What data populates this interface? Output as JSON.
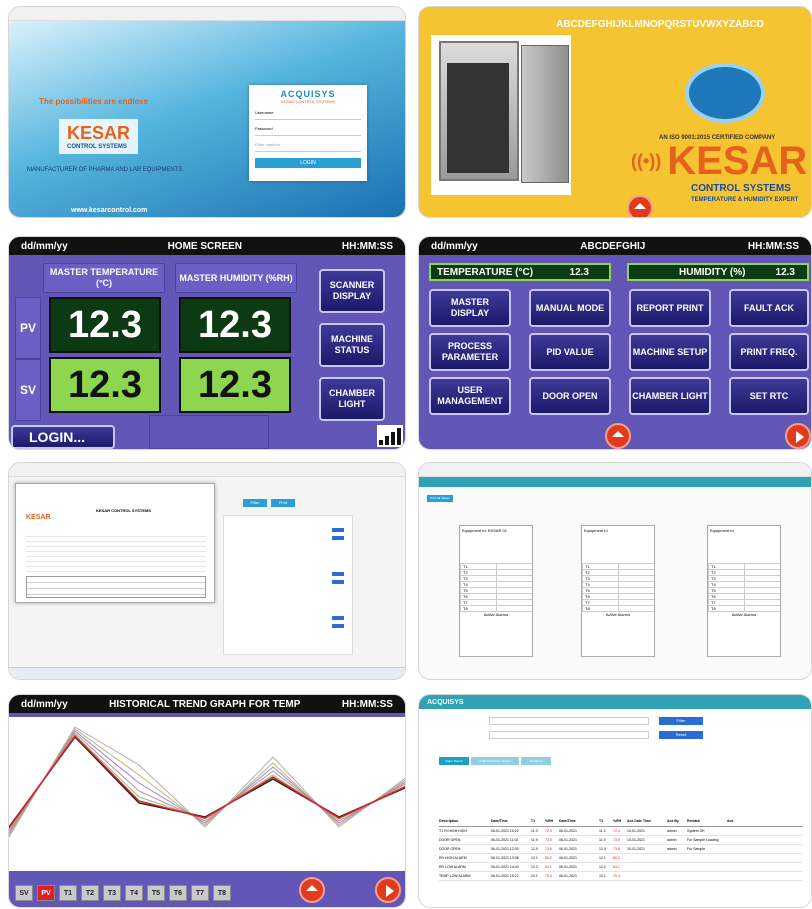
{
  "login": {
    "tagline": "The possibilities are endless",
    "brand": "KESAR",
    "brand_sub": "CONTROL SYSTEMS",
    "manufacturer": "MANUFACTURER OF PHARMA AND LAB EQUIPMENTS",
    "website": "www.kesarcontrol.com",
    "card_logo": "ACQUISYS",
    "card_sub": "KESAR CONTROL SYSTEMS",
    "username_label": "Username",
    "password_label": "Password",
    "captcha_placeholder": "Enter captcha",
    "login_button": "LOGIN"
  },
  "splash": {
    "alphabet": "ABCDEFGHIJKLMNOPQRSTUVWXYZABCD",
    "iso": "AN ISO 9001:2015 CERTIFIED COMPANY",
    "brand": "KESAR",
    "brand_sub": "CONTROL SYSTEMS",
    "tagline": "TEMPERATURE & HUMIDITY EXPERT"
  },
  "home": {
    "date": "dd/mm/yy",
    "title": "HOME SCREEN",
    "time": "HH:MM:SS",
    "temp_header": "MASTER TEMPERATURE (°C)",
    "hum_header": "MASTER HUMIDITY (%RH)",
    "pv_label": "PV",
    "sv_label": "SV",
    "pv_temp": "12.3",
    "pv_hum": "12.3",
    "sv_temp": "12.3",
    "sv_hum": "12.3",
    "scanner": "SCANNER DISPLAY",
    "machine_status": "MACHINE STATUS",
    "chamber_light": "CHAMBER LIGHT",
    "login": "LOGIN..."
  },
  "menu": {
    "date": "dd/mm/yy",
    "title": "ABCDEFGHIJ",
    "time": "HH:MM:SS",
    "temp_label": "TEMPERATURE (°C)",
    "temp_value": "12.3",
    "hum_label": "HUMIDITY (%)",
    "hum_value": "12.3",
    "buttons": [
      "MASTER DISPLAY",
      "MANUAL MODE",
      "REPORT PRINT",
      "FAULT ACK",
      "PROCESS PARAMETER",
      "PID VALUE",
      "MACHINE SETUP",
      "PRINT FREQ.",
      "USER MANAGEMENT",
      "DOOR OPEN",
      "CHAMBER LIGHT",
      "SET RTC"
    ]
  },
  "report": {
    "brand": "KESAR",
    "title": "KESAR CONTROL SYSTEMS",
    "btn_a": "Filter",
    "btn_b": "Print"
  },
  "scanner": {
    "button": "Print All Values",
    "panels": [
      {
        "title": "Equipment Id: KESAR 01"
      },
      {
        "title": "Equipment Id"
      },
      {
        "title": "Equipment Id"
      }
    ],
    "rows": [
      "T1",
      "T2",
      "T3",
      "T4",
      "T5",
      "T6",
      "T7",
      "T8"
    ],
    "alarm": "Active Alarms"
  },
  "trend": {
    "date": "dd/mm/yy",
    "title": "HISTORICAL TREND GRAPH FOR TEMP",
    "time": "HH:MM:SS",
    "tabs": [
      "SV",
      "PV",
      "T1",
      "T2",
      "T3",
      "T4",
      "T5",
      "T6",
      "T7",
      "T8"
    ]
  },
  "web": {
    "logo": "ACQUISYS",
    "tabs": [
      "Alarm Report",
      "Audit Trail Alarm Report",
      "All Report"
    ],
    "btn_search": "Filter",
    "btn_reset": "Reset",
    "cols": [
      "Description",
      "Date/Time",
      "T1",
      "%RH",
      "Date/Time",
      "T1",
      "%RH",
      "Ack Date Time",
      "Ack By",
      "Remark",
      "Ack"
    ],
    "rows": [
      [
        "T1 HI HIGH HIGH",
        "06-01-2021 10:22",
        "11.3",
        "72.4",
        "06-01-2021",
        "11.3",
        "72.4",
        "10-01-2021",
        "admin",
        "System OK"
      ],
      [
        "DOOR OPEN",
        "06-01-2021 11:02",
        "11.9",
        "73.5",
        "06-01-2021",
        "11.9",
        "73.5",
        "10-01-2021",
        "admin",
        "For Sample Loading"
      ],
      [
        "DOOR OPEN",
        "06-01-2021 12:00",
        "12.0",
        "73.6",
        "06-01-2021",
        "12.0",
        "73.6",
        "10-01-2021",
        "admin",
        "For Sample"
      ],
      [
        "RH HIGH ALARM",
        "06-01-2021 13:08",
        "12.1",
        "80.2",
        "06-01-2021",
        "12.1",
        "80.2",
        "",
        "",
        ""
      ],
      [
        "RH LOW ALARM",
        "06-01-2021 14:40",
        "12.2",
        "63.1",
        "06-01-2021",
        "12.2",
        "63.1",
        "",
        "",
        ""
      ],
      [
        "TEMP LOW ALARM",
        "06-01-2021 15:22",
        "10.1",
        "70.4",
        "06-01-2021",
        "10.1",
        "70.4",
        "",
        "",
        ""
      ]
    ]
  },
  "colors": {
    "hmi": "#6257b6",
    "navy": "#1c1a6a",
    "dark_green": "#0c3a12",
    "light_green": "#8ed64f",
    "kesar_blue": "#1a4a9a",
    "kesar_orange": "#e5621d"
  }
}
